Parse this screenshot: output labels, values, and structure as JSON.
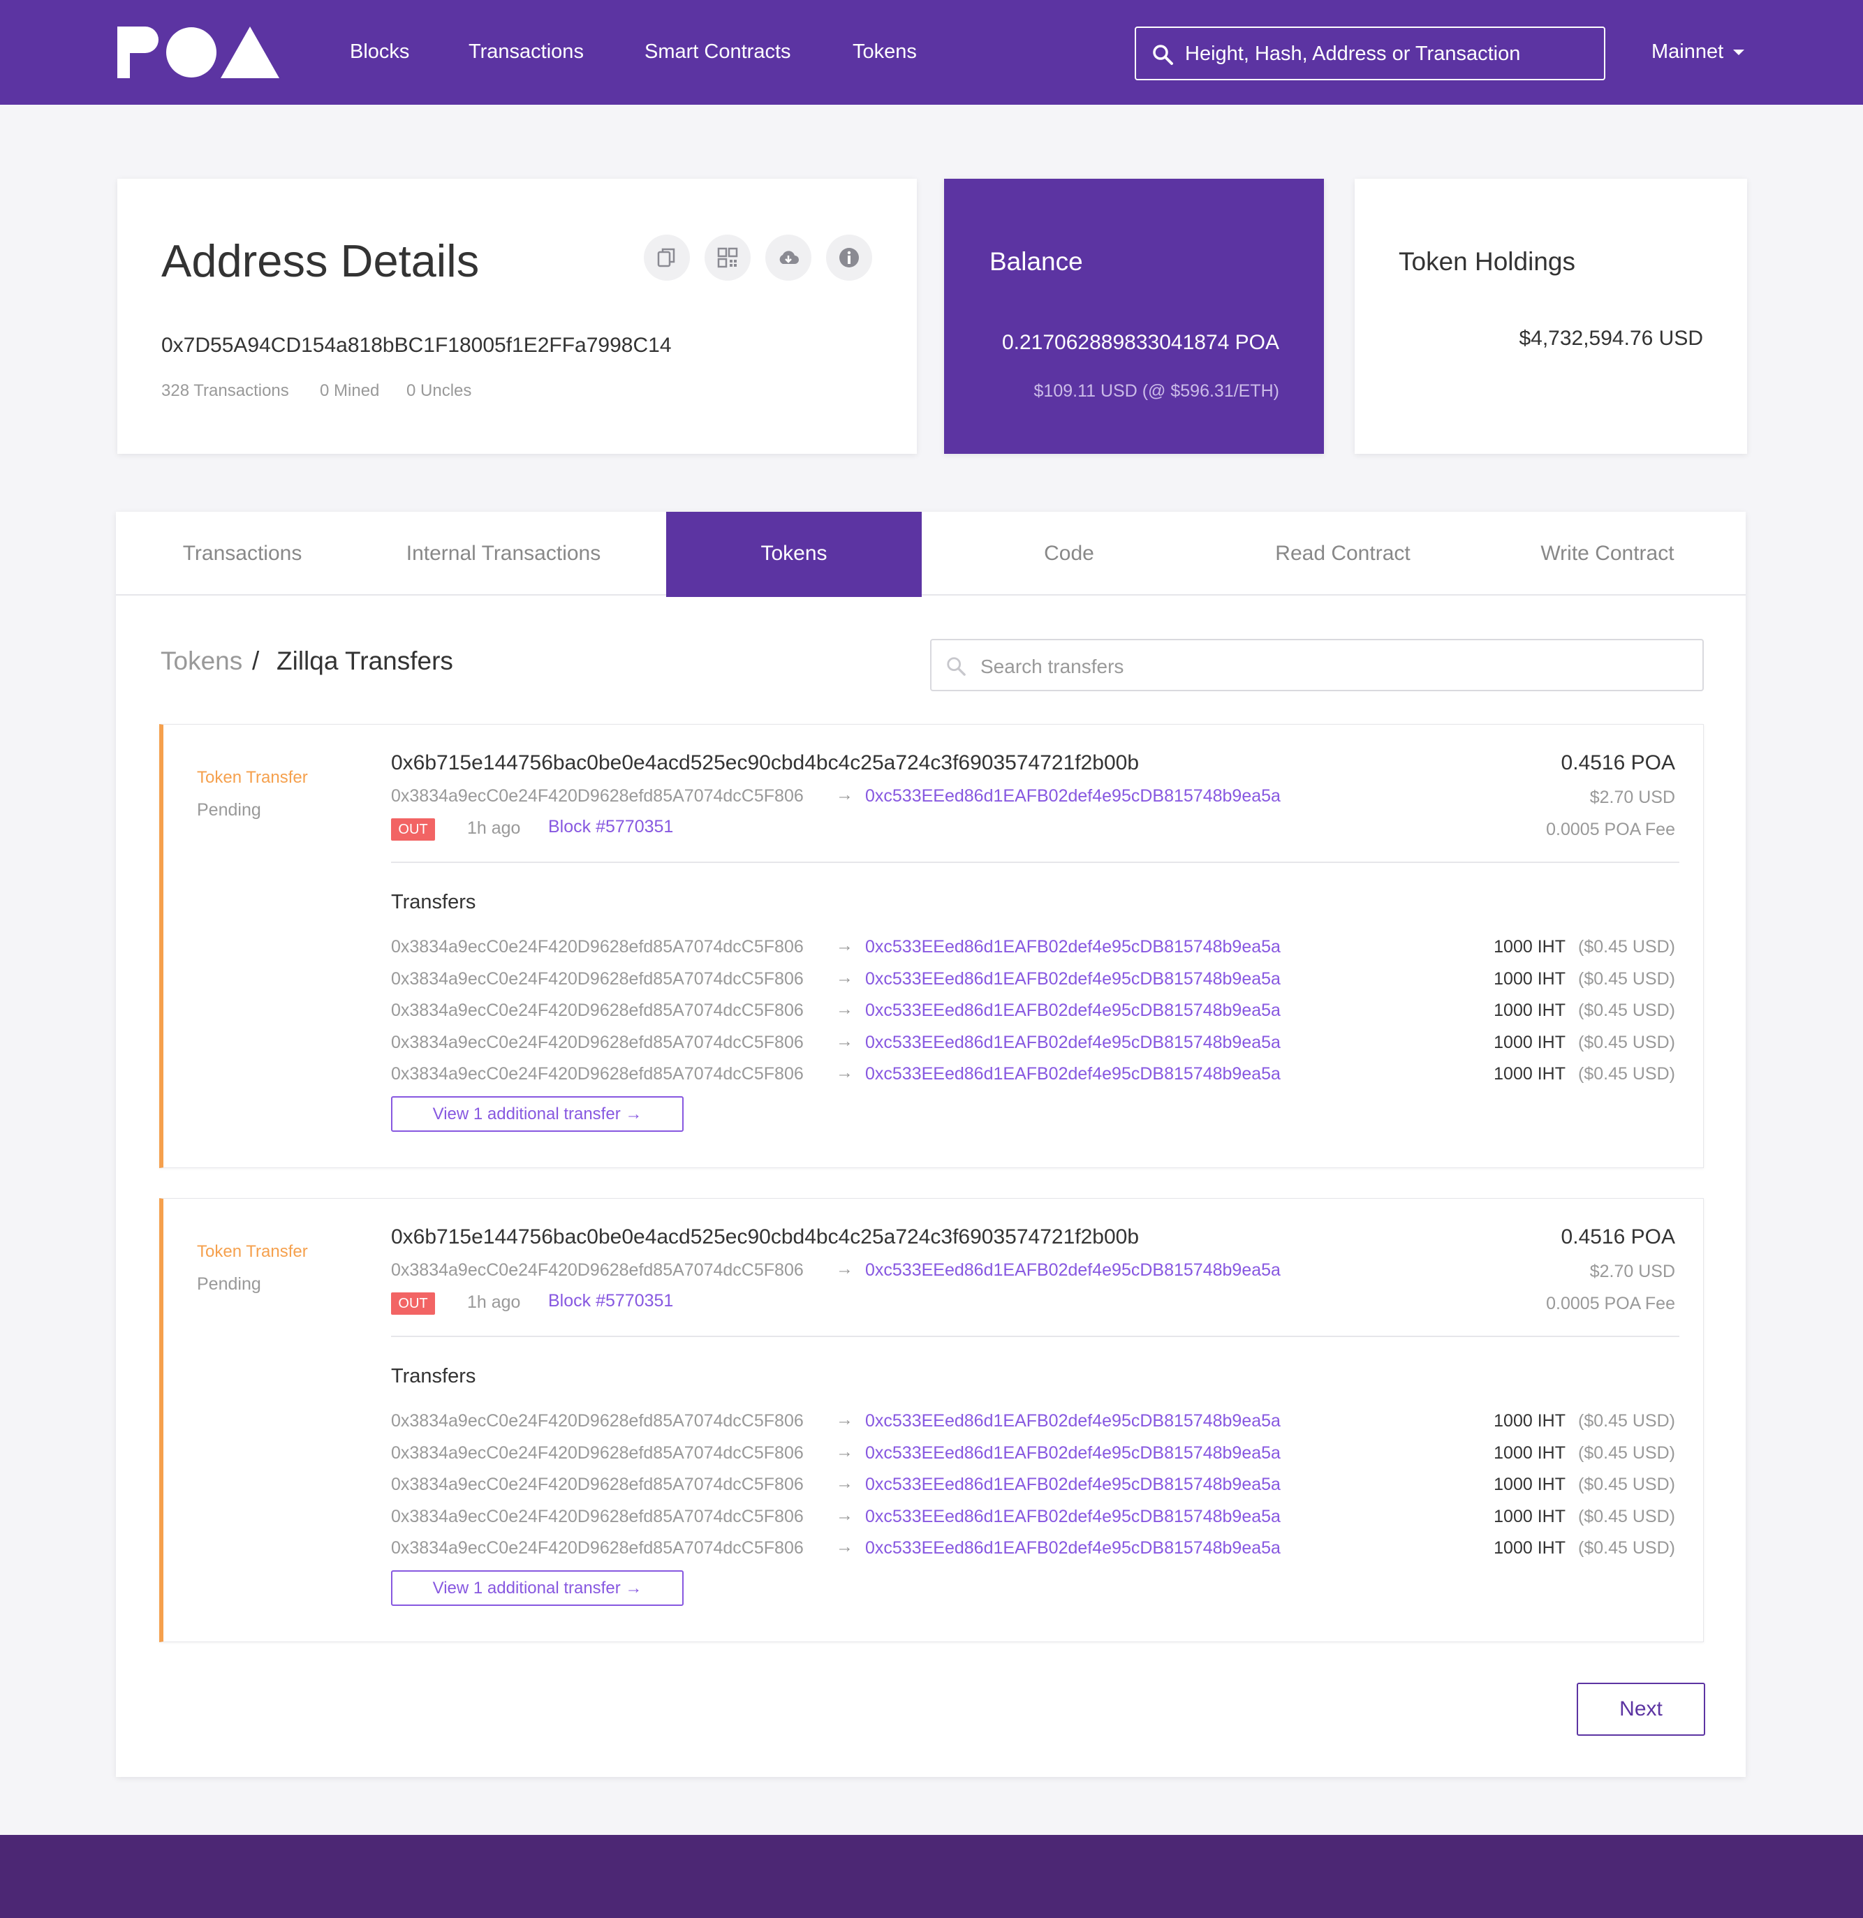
{
  "header": {
    "nav": [
      "Blocks",
      "Transactions",
      "Smart Contracts",
      "Tokens"
    ],
    "search_placeholder": "Height, Hash, Address or Transaction",
    "network": "Mainnet"
  },
  "address": {
    "title": "Address Details",
    "hash": "0x7D55A94CD154a818bBC1F18005f1E2FFa7998C14",
    "stats": [
      "328 Transactions",
      "0 Mined",
      "0 Uncles"
    ],
    "action_icons": [
      "copy-icon",
      "qr-code-icon",
      "cloud-download-icon",
      "info-icon"
    ]
  },
  "balance": {
    "title": "Balance",
    "value": "0.217062889833041874 POA",
    "usd": "$109.11 USD (@ $596.31/ETH)"
  },
  "holdings": {
    "title": "Token Holdings",
    "value": "$4,732,594.76 USD"
  },
  "tabs": [
    {
      "label": "Transactions",
      "active": false
    },
    {
      "label": "Internal Transactions",
      "active": false
    },
    {
      "label": "Tokens",
      "active": true
    },
    {
      "label": "Code",
      "active": false
    },
    {
      "label": "Read Contract",
      "active": false
    },
    {
      "label": "Write Contract",
      "active": false
    }
  ],
  "breadcrumb": {
    "root": "Tokens",
    "separator": "/",
    "current": "Zillqa Transfers"
  },
  "transfer_search_placeholder": "Search transfers",
  "transactions": [
    {
      "type": "Token Transfer",
      "status": "Pending",
      "hash": "0x6b715e144756bac0be0e4acd525ec90cbd4bc4c25a724c3f6903574721f2b00b",
      "from": "0x3834a9ecC0e24F420D9628efd85A7074dcC5F806",
      "to": "0xc533EEed86d1EAFB02def4e95cDB815748b9ea5a",
      "direction": "OUT",
      "time": "1h ago",
      "block": "Block #5770351",
      "amount": "0.4516 POA",
      "usd": "$2.70 USD",
      "fee": "0.0005 POA Fee",
      "transfers_title": "Transfers",
      "transfers": [
        {
          "from": "0x3834a9ecC0e24F420D9628efd85A7074dcC5F806",
          "to": "0xc533EEed86d1EAFB02def4e95cDB815748b9ea5a",
          "amount": "1000 IHT",
          "usd": "($0.45 USD)"
        },
        {
          "from": "0x3834a9ecC0e24F420D9628efd85A7074dcC5F806",
          "to": "0xc533EEed86d1EAFB02def4e95cDB815748b9ea5a",
          "amount": "1000 IHT",
          "usd": "($0.45 USD)"
        },
        {
          "from": "0x3834a9ecC0e24F420D9628efd85A7074dcC5F806",
          "to": "0xc533EEed86d1EAFB02def4e95cDB815748b9ea5a",
          "amount": "1000 IHT",
          "usd": "($0.45 USD)"
        },
        {
          "from": "0x3834a9ecC0e24F420D9628efd85A7074dcC5F806",
          "to": "0xc533EEed86d1EAFB02def4e95cDB815748b9ea5a",
          "amount": "1000 IHT",
          "usd": "($0.45 USD)"
        },
        {
          "from": "0x3834a9ecC0e24F420D9628efd85A7074dcC5F806",
          "to": "0xc533EEed86d1EAFB02def4e95cDB815748b9ea5a",
          "amount": "1000 IHT",
          "usd": "($0.45 USD)"
        }
      ],
      "more_label": "View 1 additional transfer →"
    },
    {
      "type": "Token Transfer",
      "status": "Pending",
      "hash": "0x6b715e144756bac0be0e4acd525ec90cbd4bc4c25a724c3f6903574721f2b00b",
      "from": "0x3834a9ecC0e24F420D9628efd85A7074dcC5F806",
      "to": "0xc533EEed86d1EAFB02def4e95cDB815748b9ea5a",
      "direction": "OUT",
      "time": "1h ago",
      "block": "Block #5770351",
      "amount": "0.4516 POA",
      "usd": "$2.70 USD",
      "fee": "0.0005 POA Fee",
      "transfers_title": "Transfers",
      "transfers": [
        {
          "from": "0x3834a9ecC0e24F420D9628efd85A7074dcC5F806",
          "to": "0xc533EEed86d1EAFB02def4e95cDB815748b9ea5a",
          "amount": "1000 IHT",
          "usd": "($0.45 USD)"
        },
        {
          "from": "0x3834a9ecC0e24F420D9628efd85A7074dcC5F806",
          "to": "0xc533EEed86d1EAFB02def4e95cDB815748b9ea5a",
          "amount": "1000 IHT",
          "usd": "($0.45 USD)"
        },
        {
          "from": "0x3834a9ecC0e24F420D9628efd85A7074dcC5F806",
          "to": "0xc533EEed86d1EAFB02def4e95cDB815748b9ea5a",
          "amount": "1000 IHT",
          "usd": "($0.45 USD)"
        },
        {
          "from": "0x3834a9ecC0e24F420D9628efd85A7074dcC5F806",
          "to": "0xc533EEed86d1EAFB02def4e95cDB815748b9ea5a",
          "amount": "1000 IHT",
          "usd": "($0.45 USD)"
        },
        {
          "from": "0x3834a9ecC0e24F420D9628efd85A7074dcC5F806",
          "to": "0xc533EEed86d1EAFB02def4e95cDB815748b9ea5a",
          "amount": "1000 IHT",
          "usd": "($0.45 USD)"
        }
      ],
      "more_label": "View 1 additional transfer →"
    }
  ],
  "pagination": {
    "next_label": "Next"
  },
  "colors": {
    "brand": "#5c34a2",
    "link": "#8758e0",
    "pending": "#f5a04d",
    "out_badge": "#f26464",
    "footer": "#4c2774"
  }
}
